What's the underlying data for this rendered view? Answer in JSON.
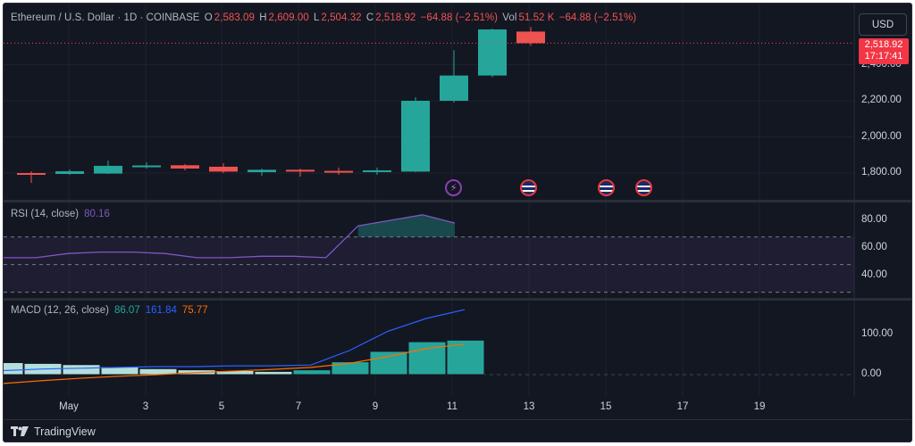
{
  "legend": {
    "symbol": "Ethereum / U.S. Dollar · 1D · COINBASE",
    "o_label": "O",
    "o_value": "2,583.09",
    "h_label": "H",
    "h_value": "2,609.00",
    "l_label": "L",
    "l_value": "2,504.32",
    "c_label": "C",
    "c_value": "2,518.92",
    "change": "−64.88 (−2.51%)",
    "vol_label": "Vol",
    "vol_value": "51.52 K",
    "vol_change": "−64.88 (−2.51%)"
  },
  "currency_button": "USD",
  "last_price": {
    "price": "2,518.92",
    "countdown": "17:17:41"
  },
  "price_axis": [
    "2,400.00",
    "2,200.00",
    "2,000.00",
    "1,800.00"
  ],
  "rsi": {
    "label": "RSI (14, close)",
    "value": "80.16",
    "axis": [
      "80.00",
      "60.00",
      "40.00"
    ],
    "values": [
      55,
      55,
      58,
      59,
      59,
      58,
      55,
      55,
      56,
      56,
      55,
      78,
      82,
      86,
      80
    ]
  },
  "macd": {
    "label": "MACD (12, 26, close)",
    "histogram_value": "86.07",
    "macd_value": "161.84",
    "signal_value": "75.77",
    "axis": [
      "100.00",
      "0.00"
    ],
    "histogram": [
      30,
      28,
      25,
      20,
      15,
      12,
      10,
      8,
      12,
      32,
      58,
      82,
      86
    ],
    "macd_line": [
      10,
      14,
      16,
      18,
      20,
      20,
      22,
      22,
      24,
      60,
      108,
      140,
      162
    ],
    "signal_line": [
      -22,
      -15,
      -9,
      -4,
      0,
      5,
      9,
      13,
      18,
      28,
      45,
      65,
      76
    ]
  },
  "x_axis": [
    "May",
    "3",
    "5",
    "7",
    "9",
    "11",
    "13",
    "15",
    "17",
    "19"
  ],
  "footer": {
    "brand": "TradingView"
  },
  "colors": {
    "up": "#26a69a",
    "down": "#ef5350",
    "rsi": "#7e57c2",
    "macd": "#2962ff",
    "signal": "#ff6d00"
  },
  "chart_data": {
    "type": "candlestick",
    "symbol": "ETH/USD",
    "ylim": [
      1650,
      2620
    ],
    "candles": [
      {
        "o": 1800,
        "h": 1810,
        "l": 1745,
        "c": 1795
      },
      {
        "o": 1795,
        "h": 1820,
        "l": 1790,
        "c": 1810
      },
      {
        "o": 1797,
        "h": 1870,
        "l": 1795,
        "c": 1840
      },
      {
        "o": 1838,
        "h": 1860,
        "l": 1825,
        "c": 1842
      },
      {
        "o": 1843,
        "h": 1850,
        "l": 1815,
        "c": 1825
      },
      {
        "o": 1835,
        "h": 1855,
        "l": 1800,
        "c": 1808
      },
      {
        "o": 1805,
        "h": 1825,
        "l": 1785,
        "c": 1818
      },
      {
        "o": 1818,
        "h": 1825,
        "l": 1780,
        "c": 1812
      },
      {
        "o": 1812,
        "h": 1830,
        "l": 1790,
        "c": 1810
      },
      {
        "o": 1810,
        "h": 1830,
        "l": 1790,
        "c": 1815
      },
      {
        "o": 1808,
        "h": 2220,
        "l": 1805,
        "c": 2200
      },
      {
        "o": 2200,
        "h": 2480,
        "l": 2190,
        "c": 2340
      },
      {
        "o": 2340,
        "h": 2600,
        "l": 2330,
        "c": 2595
      },
      {
        "o": 2583.09,
        "h": 2609.0,
        "l": 2504.32,
        "c": 2518.92
      }
    ]
  }
}
